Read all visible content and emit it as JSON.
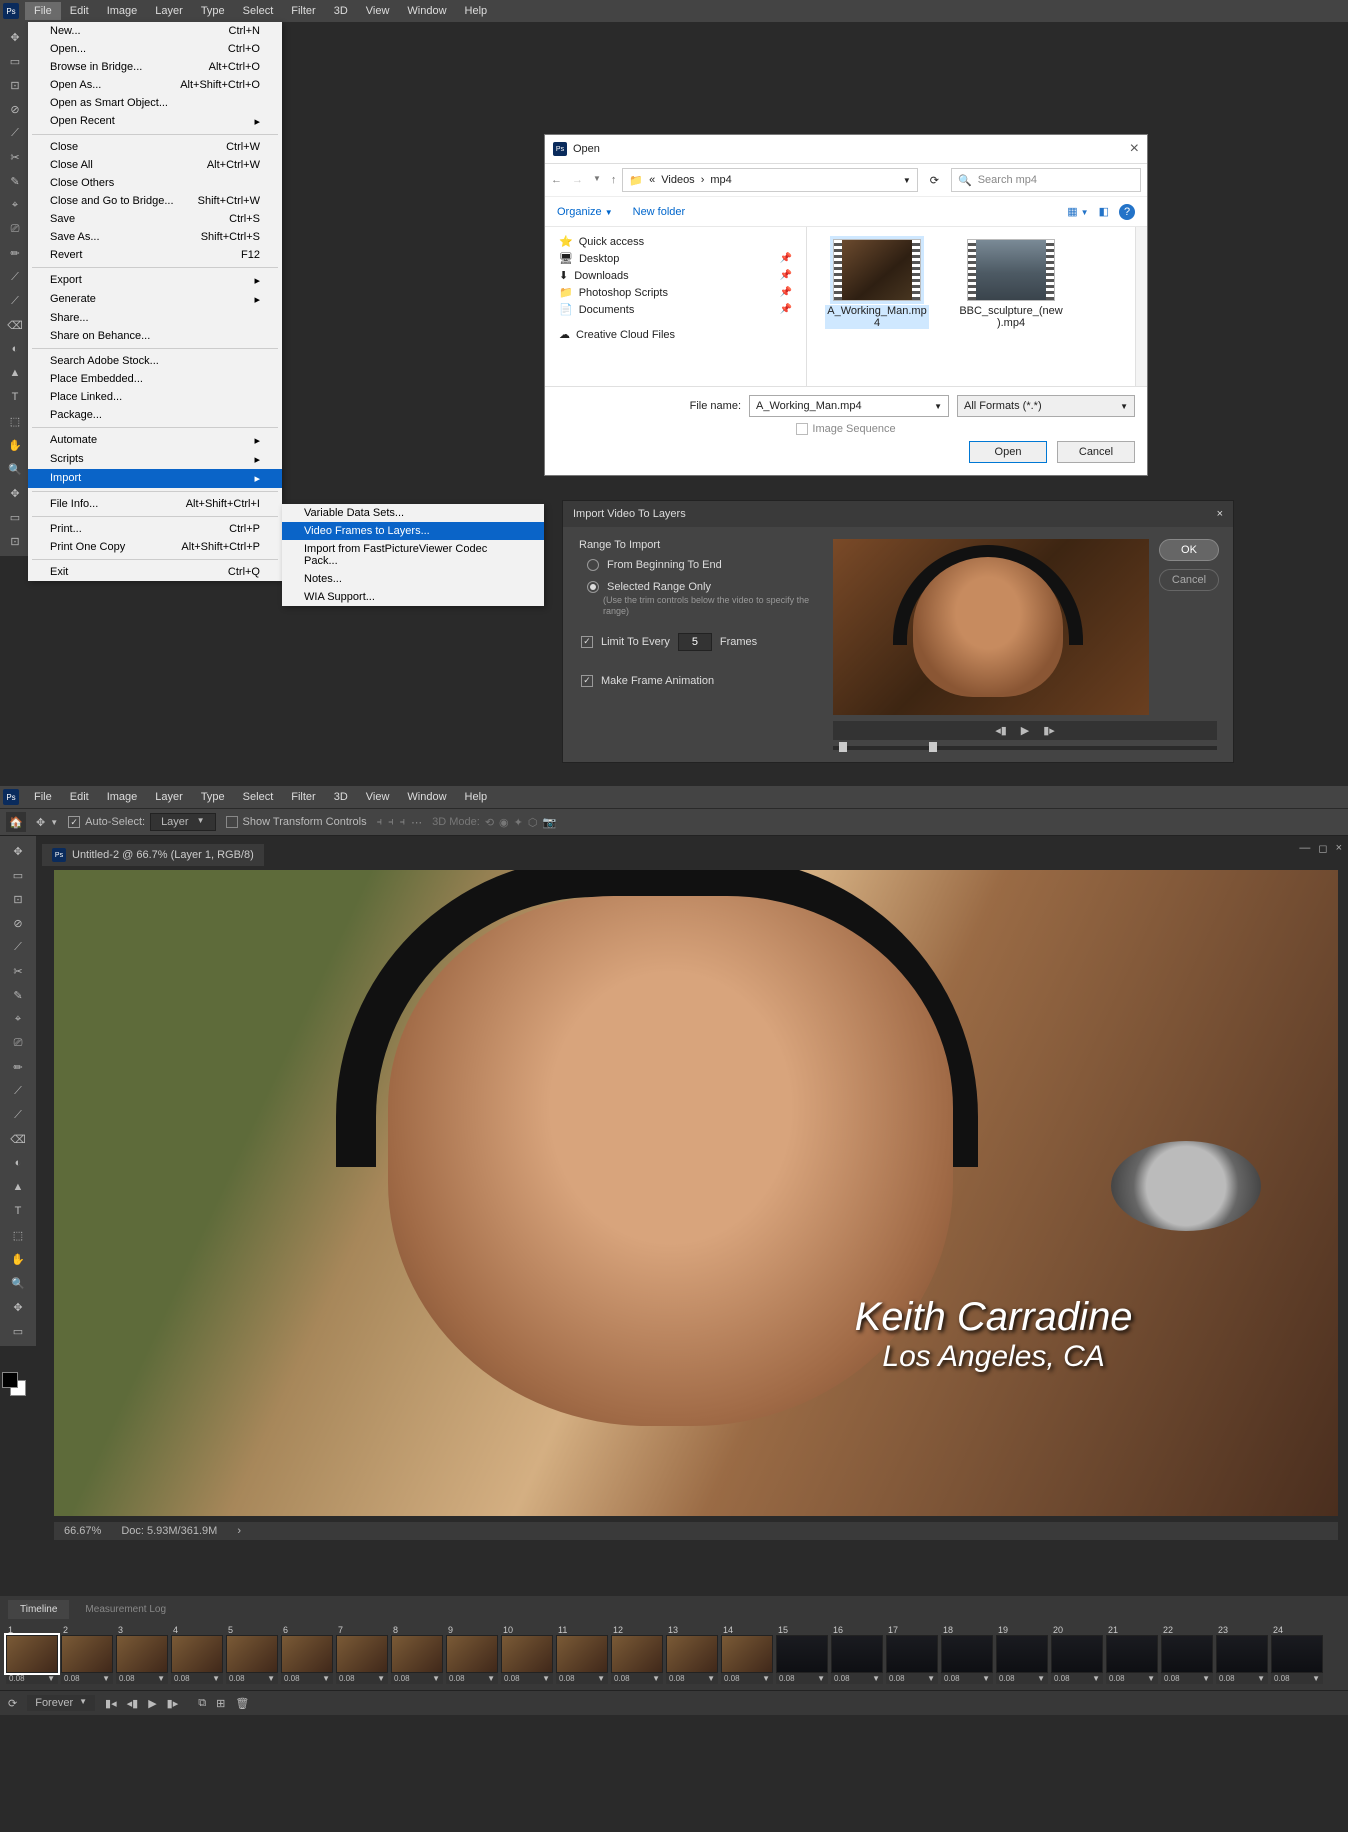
{
  "menu": {
    "items": [
      "File",
      "Edit",
      "Image",
      "Layer",
      "Type",
      "Select",
      "Filter",
      "3D",
      "View",
      "Window",
      "Help"
    ],
    "active": 0
  },
  "file_menu": [
    {
      "label": "New...",
      "accel": "Ctrl+N"
    },
    {
      "label": "Open...",
      "accel": "Ctrl+O"
    },
    {
      "label": "Browse in Bridge...",
      "accel": "Alt+Ctrl+O"
    },
    {
      "label": "Open As...",
      "accel": "Alt+Shift+Ctrl+O"
    },
    {
      "label": "Open as Smart Object..."
    },
    {
      "label": "Open Recent",
      "arrow": true
    },
    {
      "sep": true
    },
    {
      "label": "Close",
      "accel": "Ctrl+W"
    },
    {
      "label": "Close All",
      "accel": "Alt+Ctrl+W"
    },
    {
      "label": "Close Others"
    },
    {
      "label": "Close and Go to Bridge...",
      "accel": "Shift+Ctrl+W"
    },
    {
      "label": "Save",
      "accel": "Ctrl+S"
    },
    {
      "label": "Save As...",
      "accel": "Shift+Ctrl+S"
    },
    {
      "label": "Revert",
      "accel": "F12"
    },
    {
      "sep": true
    },
    {
      "label": "Export",
      "arrow": true
    },
    {
      "label": "Generate",
      "arrow": true
    },
    {
      "label": "Share..."
    },
    {
      "label": "Share on Behance..."
    },
    {
      "sep": true
    },
    {
      "label": "Search Adobe Stock..."
    },
    {
      "label": "Place Embedded..."
    },
    {
      "label": "Place Linked..."
    },
    {
      "label": "Package..."
    },
    {
      "sep": true
    },
    {
      "label": "Automate",
      "arrow": true
    },
    {
      "label": "Scripts",
      "arrow": true
    },
    {
      "label": "Import",
      "arrow": true,
      "selected": true
    },
    {
      "sep": true
    },
    {
      "label": "File Info...",
      "accel": "Alt+Shift+Ctrl+I"
    },
    {
      "sep": true
    },
    {
      "label": "Print...",
      "accel": "Ctrl+P"
    },
    {
      "label": "Print One Copy",
      "accel": "Alt+Shift+Ctrl+P"
    },
    {
      "sep": true
    },
    {
      "label": "Exit",
      "accel": "Ctrl+Q"
    }
  ],
  "import_submenu": [
    {
      "label": "Variable Data Sets..."
    },
    {
      "label": "Video Frames to Layers...",
      "selected": true
    },
    {
      "label": "Import from FastPictureViewer Codec Pack..."
    },
    {
      "label": "Notes..."
    },
    {
      "label": "WIA Support..."
    }
  ],
  "open_dialog": {
    "title": "Open",
    "path_prefix": "«",
    "path_parts": [
      "Videos",
      "mp4"
    ],
    "search_placeholder": "Search mp4",
    "organize": "Organize",
    "new_folder": "New folder",
    "tree": [
      {
        "icon": "star",
        "label": "Quick access"
      },
      {
        "icon": "desktop",
        "label": "Desktop",
        "pin": true
      },
      {
        "icon": "down",
        "label": "Downloads",
        "pin": true
      },
      {
        "icon": "folder",
        "label": "Photoshop Scripts",
        "pin": true
      },
      {
        "icon": "doc",
        "label": "Documents",
        "pin": true
      },
      {
        "sep": true
      },
      {
        "icon": "cloud",
        "label": "Creative Cloud Files"
      }
    ],
    "files": [
      {
        "name": "A_Working_Man.mp4",
        "selected": true,
        "img": 1
      },
      {
        "name": "BBC_sculpture_(new).mp4",
        "img": 2
      }
    ],
    "file_name_label": "File name:",
    "file_name_value": "A_Working_Man.mp4",
    "format": "All Formats (*.*)",
    "image_sequence": "Image Sequence",
    "open_btn": "Open",
    "cancel_btn": "Cancel"
  },
  "import_dialog": {
    "title": "Import Video To Layers",
    "range_label": "Range To Import",
    "opt_begin": "From Beginning To End",
    "opt_sel": "Selected Range Only",
    "hint": "(Use the trim controls below the video to specify the range)",
    "limit_label": "Limit To Every",
    "limit_value": "5",
    "frames": "Frames",
    "make_anim": "Make Frame Animation",
    "ok": "OK",
    "cancel": "Cancel"
  },
  "options_bar": {
    "auto_select": "Auto-Select:",
    "auto_select_value": "Layer",
    "show_transform": "Show Transform Controls",
    "mode_label": "3D Mode:"
  },
  "doc": {
    "title": "Untitled-2 @ 66.7% (Layer 1, RGB/8)",
    "caption_line1": "Keith Carradine",
    "caption_line2": "Los Angeles, CA",
    "zoom": "66.67%",
    "docsize": "Doc: 5.93M/361.9M"
  },
  "timeline": {
    "tab1": "Timeline",
    "tab2": "Measurement Log",
    "frame_count": 24,
    "duration": "0.08",
    "loop_label": "Forever",
    "dark_from": 15
  }
}
